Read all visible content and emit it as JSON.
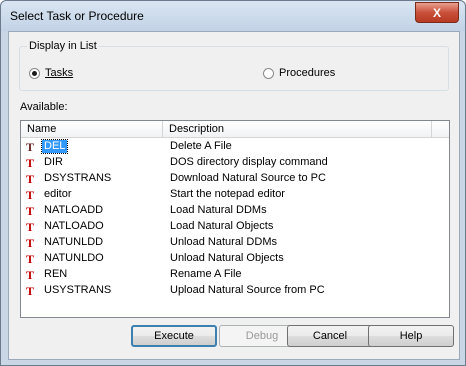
{
  "window": {
    "title": "Select Task or Procedure",
    "close_glyph": "X"
  },
  "display_group": {
    "legend": "Display in List",
    "options": [
      {
        "label": "Tasks",
        "checked": true
      },
      {
        "label": "Procedures",
        "checked": false
      }
    ]
  },
  "available_label": "Available:",
  "list": {
    "columns": [
      "Name",
      "Description"
    ],
    "rows": [
      {
        "icon": "task-icon",
        "name": "DEL",
        "description": "Delete A File",
        "selected": true
      },
      {
        "icon": "task-icon",
        "name": "DIR",
        "description": "DOS directory display command",
        "selected": false
      },
      {
        "icon": "task-icon",
        "name": "DSYSTRANS",
        "description": "Download Natural Source to PC",
        "selected": false
      },
      {
        "icon": "task-icon",
        "name": "editor",
        "description": "Start the notepad editor",
        "selected": false
      },
      {
        "icon": "task-icon",
        "name": "NATLOADD",
        "description": "Load Natural DDMs",
        "selected": false
      },
      {
        "icon": "task-icon",
        "name": "NATLOADO",
        "description": "Load Natural Objects",
        "selected": false
      },
      {
        "icon": "task-icon",
        "name": "NATUNLDD",
        "description": "Unload Natural DDMs",
        "selected": false
      },
      {
        "icon": "task-icon",
        "name": "NATUNLDO",
        "description": "Unload Natural Objects",
        "selected": false
      },
      {
        "icon": "task-icon",
        "name": "REN",
        "description": "Rename A File",
        "selected": false
      },
      {
        "icon": "task-icon",
        "name": "USYSTRANS",
        "description": "Upload Natural Source from PC",
        "selected": false
      }
    ],
    "icon_glyph": "T"
  },
  "buttons": {
    "execute": "Execute",
    "debug": "Debug",
    "cancel": "Cancel",
    "help": "Help"
  },
  "colors": {
    "task_icon": "#c00000",
    "selection": "#3399ff"
  }
}
